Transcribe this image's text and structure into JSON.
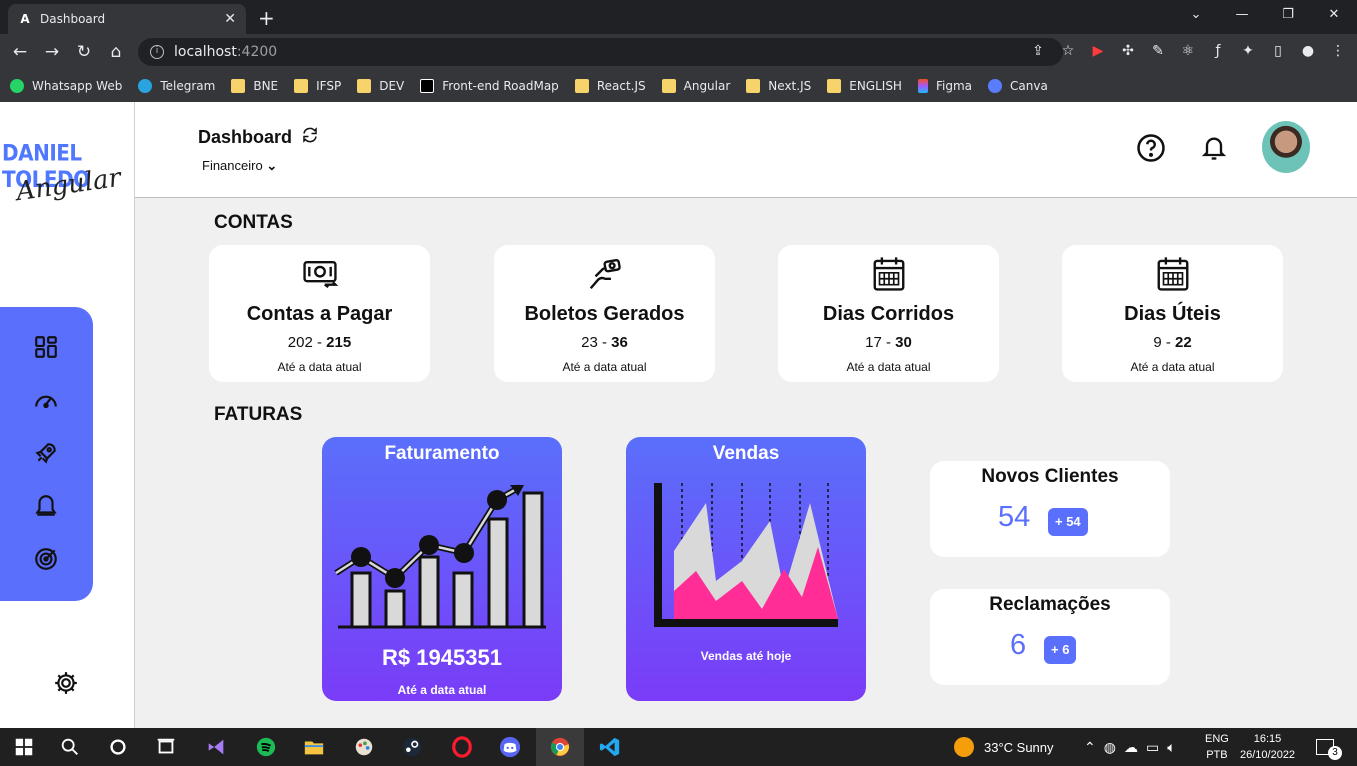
{
  "browser": {
    "tab_title": "Dashboard",
    "tab_favicon": "A",
    "url_host": "localhost",
    "url_port": ":4200",
    "bookmarks": [
      "Whatsapp Web",
      "Telegram",
      "BNE",
      "IFSP",
      "DEV",
      "Front-end RoadMap",
      "React.JS",
      "Angular",
      "Next.JS",
      "ENGLISH",
      "Figma",
      "Canva"
    ]
  },
  "sidebar": {
    "logo_line1": "DANIEL TOLEDO",
    "logo_line2": "Angular",
    "nav_icons": [
      "dashboard-grid-icon",
      "speedometer-icon",
      "rocket-icon",
      "bell-outline-icon",
      "target-icon"
    ],
    "settings_icon": "gear-icon"
  },
  "header": {
    "title": "Dashboard",
    "subtitle": "Financeiro"
  },
  "contas": {
    "section_title": "CONTAS",
    "cards": [
      {
        "title": "Contas a Pagar",
        "value_a": "202",
        "value_b": "215",
        "subtitle": "Até a data atual",
        "icon": "money-bill-icon"
      },
      {
        "title": "Boletos Gerados",
        "value_a": "23",
        "value_b": "36",
        "subtitle": "Até a data atual",
        "icon": "hand-money-icon"
      },
      {
        "title": "Dias Corridos",
        "value_a": "17",
        "value_b": "30",
        "subtitle": "Até a data atual",
        "icon": "calendar-icon"
      },
      {
        "title": "Dias Úteis",
        "value_a": "9",
        "value_b": "22",
        "subtitle": "Até a data atual",
        "icon": "calendar-icon"
      }
    ]
  },
  "faturas": {
    "section_title": "FATURAS",
    "faturamento": {
      "title": "Faturamento",
      "value": "R$ 1945351",
      "subtitle": "Até a data atual"
    },
    "vendas": {
      "title": "Vendas",
      "subtitle": "Vendas até hoje"
    },
    "novos_clientes": {
      "title": "Novos Clientes",
      "value": "54",
      "badge": "+ 54"
    },
    "reclamacoes": {
      "title": "Reclamações",
      "value": "6",
      "badge": "+ 6"
    }
  },
  "taskbar": {
    "weather": "33°C  Sunny",
    "lang1": "ENG",
    "lang2": "PTB",
    "time": "16:15",
    "date": "26/10/2022",
    "notifications": "3"
  },
  "colors": {
    "accent": "#5b6ffd",
    "gradient_end": "#7a3cf8",
    "pink": "#ff2d95"
  }
}
